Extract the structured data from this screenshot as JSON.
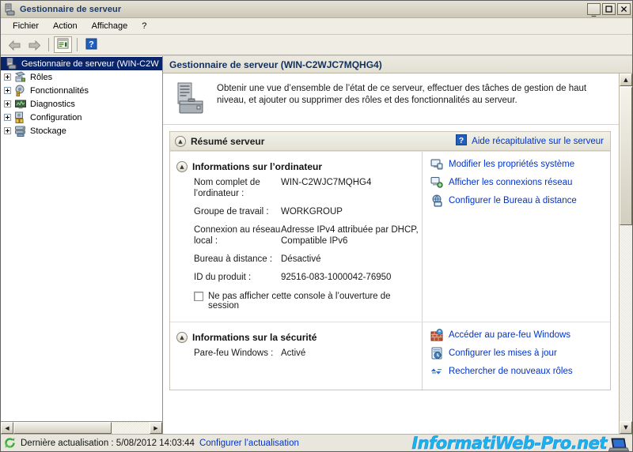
{
  "window": {
    "title": "Gestionnaire de serveur",
    "icon": "server-manager-icon",
    "buttons": {
      "minimize": "_",
      "maximize": "☐",
      "close": "✕"
    }
  },
  "menubar": {
    "items": [
      {
        "label": "Fichier",
        "name": "menu-fichier"
      },
      {
        "label": "Action",
        "name": "menu-action"
      },
      {
        "label": "Affichage",
        "name": "menu-affichage"
      },
      {
        "label": "?",
        "name": "menu-help"
      }
    ]
  },
  "toolbar": {
    "items": [
      {
        "name": "back-button",
        "icon": "left-arrow-icon"
      },
      {
        "name": "forward-button",
        "icon": "right-arrow-icon"
      },
      {
        "name": "properties-button",
        "icon": "properties-icon"
      },
      {
        "name": "help-button",
        "icon": "question-mark-icon"
      }
    ]
  },
  "tree": {
    "root": {
      "label": "Gestionnaire de serveur (WIN-C2W",
      "selected": true,
      "icon": "server-manager-icon"
    },
    "items": [
      {
        "label": "Rôles",
        "icon": "roles-icon"
      },
      {
        "label": "Fonctionnalités",
        "icon": "features-icon"
      },
      {
        "label": "Diagnostics",
        "icon": "diagnostics-icon"
      },
      {
        "label": "Configuration",
        "icon": "configuration-icon"
      },
      {
        "label": "Stockage",
        "icon": "storage-icon"
      }
    ]
  },
  "content": {
    "header": "Gestionnaire de serveur (WIN-C2WJC7MQHG4)",
    "intro": "Obtenir une vue d’ensemble de l’état de ce serveur, effectuer des tâches de gestion de haut niveau, et ajouter ou supprimer des rôles et des fonctionnalités au serveur.",
    "intro_icon": "server-toolbox-icon",
    "summary_panel": {
      "title": "Résumé serveur",
      "help_link": "Aide récapitulative sur le serveur",
      "help_icon": "help-question-icon"
    },
    "computer_section": {
      "title": "Informations sur l’ordinateur",
      "fields": [
        {
          "label": "Nom complet de l’ordinateur :",
          "value": "WIN-C2WJC7MQHG4"
        },
        {
          "label": "Groupe de travail :",
          "value": "WORKGROUP"
        },
        {
          "label": "Connexion au réseau local :",
          "value": "Adresse IPv4 attribuée par DHCP, Compatible IPv6"
        },
        {
          "label": "Bureau à distance :",
          "value": "Désactivé"
        },
        {
          "label": "ID du produit :",
          "value": "92516-083-1000042-76950"
        }
      ],
      "checkbox": {
        "label": "Ne pas afficher cette console à l’ouverture de session",
        "checked": false
      },
      "actions": [
        {
          "label": "Modifier les propriétés système",
          "icon": "system-properties-icon"
        },
        {
          "label": "Afficher les connexions réseau",
          "icon": "network-connections-icon"
        },
        {
          "label": "Configurer le Bureau à distance",
          "icon": "remote-desktop-icon"
        }
      ]
    },
    "security_section": {
      "title": "Informations sur la sécurité",
      "fields": [
        {
          "label": "Pare-feu Windows :",
          "value": "Activé"
        }
      ],
      "actions": [
        {
          "label": "Accéder au pare-feu Windows",
          "icon": "firewall-icon"
        },
        {
          "label": "Configurer les mises à jour",
          "icon": "windows-update-icon"
        },
        {
          "label": "Rechercher de nouveaux rôles",
          "icon": "check-roles-icon"
        }
      ]
    }
  },
  "statusbar": {
    "icon": "refresh-icon",
    "text": "Dernière actualisation : 5/08/2012 14:03:44",
    "link": "Configurer l’actualisation"
  },
  "watermark": {
    "text": "InformatiWeb-Pro.net",
    "icon": "laptop-icon"
  },
  "colors": {
    "accent_link": "#0033cc",
    "title_text": "#1a3a6b",
    "selection": "#0a246a",
    "watermark": "#16b3ee"
  }
}
